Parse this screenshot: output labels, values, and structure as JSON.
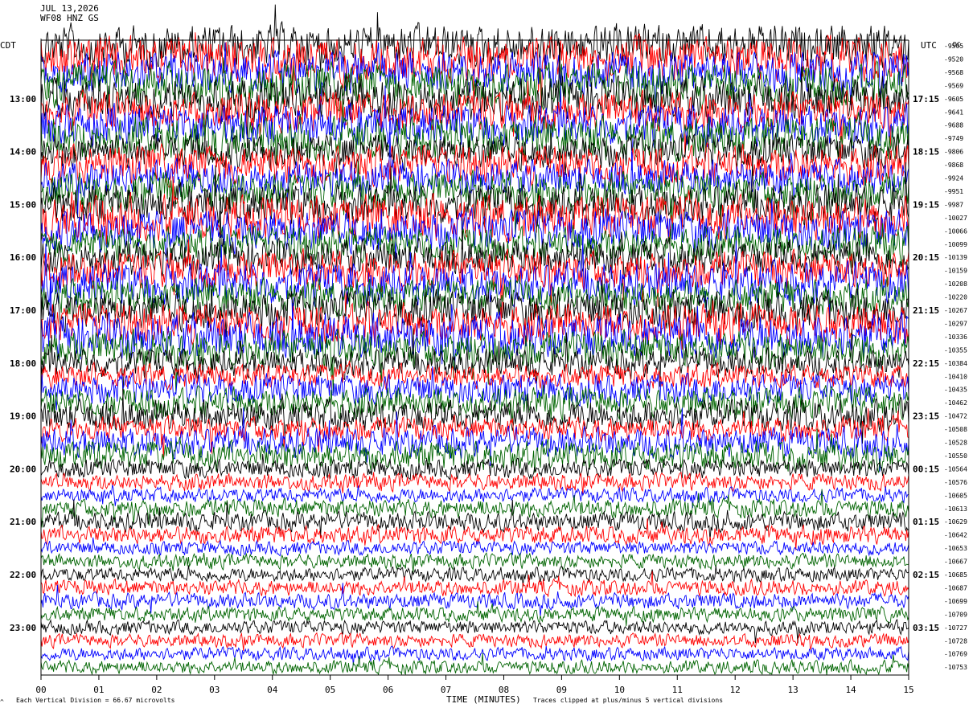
{
  "header": {
    "date": "JUL 13,2026",
    "station": "WF08 HNZ GS"
  },
  "axes": {
    "left_tz": "CDT",
    "right_tz": "UTC",
    "dc_label": "DC",
    "xlabel": "TIME (MINUTES)"
  },
  "footer": {
    "left_note": "Each Vertical Division = 66.67 microvolts",
    "right_note": "Traces clipped at plus/minus 5 vertical divisions"
  },
  "chart_data": {
    "type": "helicorder",
    "title": "",
    "xlabel": "TIME (MINUTES)",
    "x_ticks": [
      "00",
      "01",
      "02",
      "03",
      "04",
      "05",
      "06",
      "07",
      "08",
      "09",
      "10",
      "11",
      "12",
      "13",
      "14",
      "15"
    ],
    "xlim": [
      0,
      15
    ],
    "left_hour_labels": [
      "13:00",
      "14:00",
      "15:00",
      "16:00",
      "17:00",
      "18:00",
      "19:00",
      "20:00",
      "21:00",
      "22:00",
      "23:00"
    ],
    "right_hour_labels": [
      "17:15",
      "18:15",
      "19:15",
      "20:15",
      "21:15",
      "22:15",
      "23:15",
      "00:15",
      "01:15",
      "02:15",
      "03:15"
    ],
    "dc_offsets": [
      "-9505",
      "-9520",
      "-9568",
      "-9569",
      "-9605",
      "-9641",
      "-9688",
      "-9749",
      "-9806",
      "-9868",
      "-9924",
      "-9951",
      "-9987",
      "-10027",
      "-10066",
      "-10099",
      "-10139",
      "-10159",
      "-10208",
      "-10220",
      "-10267",
      "-10297",
      "-10336",
      "-10355",
      "-10384",
      "-10410",
      "-10435",
      "-10462",
      "-10472",
      "-10508",
      "-10528",
      "-10550",
      "-10564",
      "-10576",
      "-10605",
      "-10613",
      "-10629",
      "-10642",
      "-10653",
      "-10667",
      "-10685",
      "-10687",
      "-10699",
      "-10709",
      "-10727",
      "-10728",
      "-10769",
      "-10753"
    ],
    "trace_colors": [
      "#000000",
      "#ff0000",
      "#0000ff",
      "#006400"
    ],
    "rows_per_hour": 4,
    "minutes_per_row": 15,
    "vertical_division_microvolts": 66.67,
    "clip_divisions": 5
  }
}
